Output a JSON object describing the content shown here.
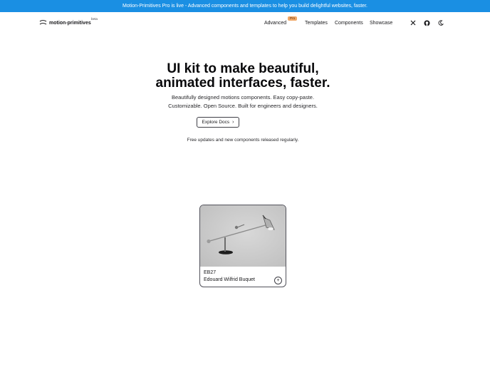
{
  "banner": {
    "text": "Motion-Primitives Pro is live - Advanced components and templates to help you build delightful websites, faster."
  },
  "header": {
    "brand": "motion-primitives",
    "beta": "beta",
    "nav": {
      "advanced": "Advanced",
      "pro_badge": "Pro",
      "templates": "Templates",
      "components": "Components",
      "showcase": "Showcase"
    },
    "icons": [
      "x-logo-icon",
      "github-icon",
      "moon-icon"
    ]
  },
  "hero": {
    "title_line1": "UI kit to make beautiful,",
    "title_line2": "animated interfaces, faster.",
    "subtitle_line1": "Beautifully designed motions components. Easy copy-paste.",
    "subtitle_line2": "Customizable. Open Source. Built for engineers and designers.",
    "cta": "Explore Docs",
    "cta_icon": "chevron-right-icon",
    "updates": "Free updates and new components released regularly."
  },
  "card": {
    "model": "EB27",
    "designer": "Edouard Wilfrid Buquet",
    "action_icon": "plus-icon",
    "action_label": "+"
  },
  "colors": {
    "banner": "#1a8fe3",
    "pro_badge": "#f0a868",
    "text": "#18181b"
  }
}
